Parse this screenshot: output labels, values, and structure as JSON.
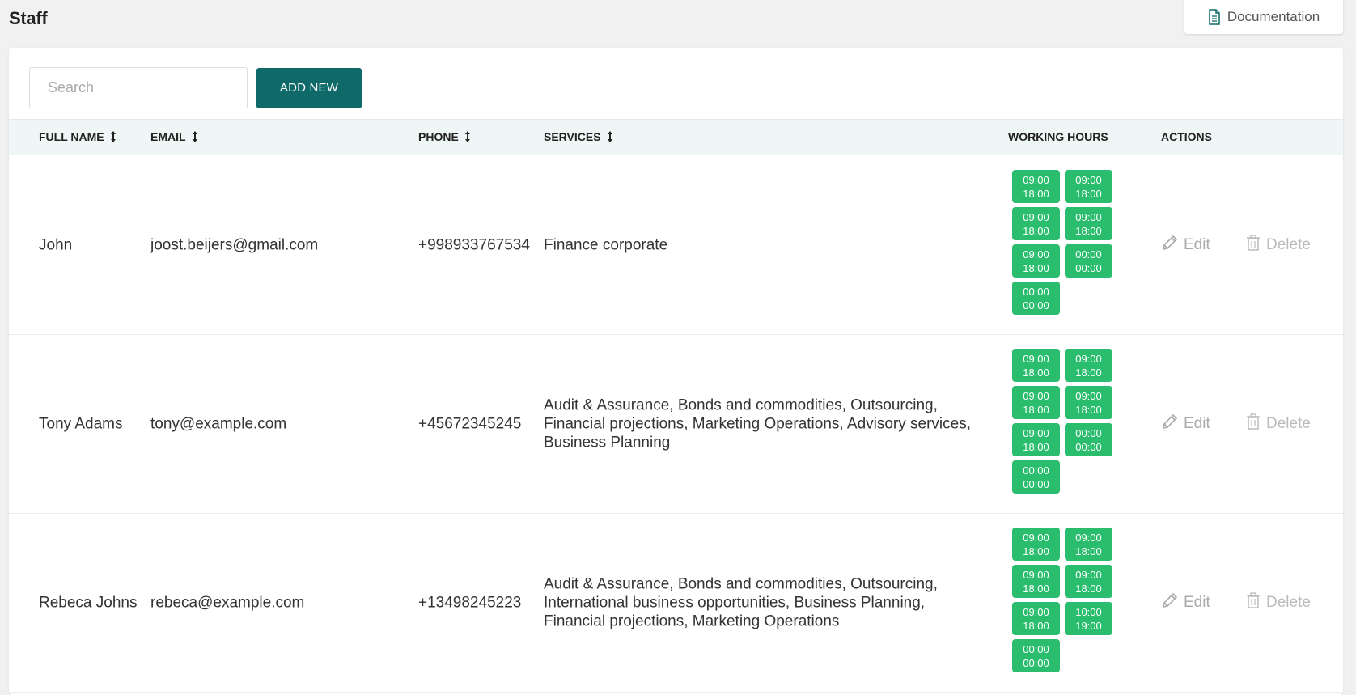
{
  "page": {
    "title": "Staff"
  },
  "documentation": {
    "label": "Documentation",
    "icon": "document-icon"
  },
  "toolbar": {
    "search_placeholder": "Search",
    "search_value": "",
    "add_new_label": "ADD NEW"
  },
  "table": {
    "columns": {
      "full_name": "FULL NAME",
      "email": "EMAIL",
      "phone": "PHONE",
      "services": "SERVICES",
      "working_hours": "WORKING HOURS",
      "actions": "ACTIONS"
    },
    "rows": [
      {
        "full_name": "John",
        "email": "joost.beijers@gmail.com",
        "phone": "+998933767534",
        "services": [
          "Finance corporate"
        ],
        "hours": [
          {
            "start": "09:00",
            "end": "18:00"
          },
          {
            "start": "09:00",
            "end": "18:00"
          },
          {
            "start": "09:00",
            "end": "18:00"
          },
          {
            "start": "09:00",
            "end": "18:00"
          },
          {
            "start": "09:00",
            "end": "18:00"
          },
          {
            "start": "00:00",
            "end": "00:00"
          },
          {
            "start": "00:00",
            "end": "00:00"
          }
        ],
        "edit_label": "Edit",
        "delete_label": "Delete"
      },
      {
        "full_name": "Tony Adams",
        "email": "tony@example.com",
        "phone": "+45672345245",
        "services": [
          "Audit & Assurance, Bonds and commodities, Outsourcing,",
          "Financial projections, Marketing Operations, Advisory services,",
          "Business Planning"
        ],
        "hours": [
          {
            "start": "09:00",
            "end": "18:00"
          },
          {
            "start": "09:00",
            "end": "18:00"
          },
          {
            "start": "09:00",
            "end": "18:00"
          },
          {
            "start": "09:00",
            "end": "18:00"
          },
          {
            "start": "09:00",
            "end": "18:00"
          },
          {
            "start": "00:00",
            "end": "00:00"
          },
          {
            "start": "00:00",
            "end": "00:00"
          }
        ],
        "edit_label": "Edit",
        "delete_label": "Delete"
      },
      {
        "full_name": "Rebeca Johns",
        "email": "rebeca@example.com",
        "phone": "+13498245223",
        "services": [
          "Audit & Assurance, Bonds and commodities, Outsourcing,",
          "International business opportunities, Business Planning,",
          "Financial projections, Marketing Operations"
        ],
        "hours": [
          {
            "start": "09:00",
            "end": "18:00"
          },
          {
            "start": "09:00",
            "end": "18:00"
          },
          {
            "start": "09:00",
            "end": "18:00"
          },
          {
            "start": "09:00",
            "end": "18:00"
          },
          {
            "start": "09:00",
            "end": "18:00"
          },
          {
            "start": "10:00",
            "end": "19:00"
          },
          {
            "start": "00:00",
            "end": "00:00"
          }
        ],
        "edit_label": "Edit",
        "delete_label": "Delete"
      }
    ]
  },
  "colors": {
    "primary": "#0f6968",
    "hours_chip": "#2bbd6e",
    "header_bg": "#eef7f6",
    "page_bg": "#f1f1f1"
  }
}
